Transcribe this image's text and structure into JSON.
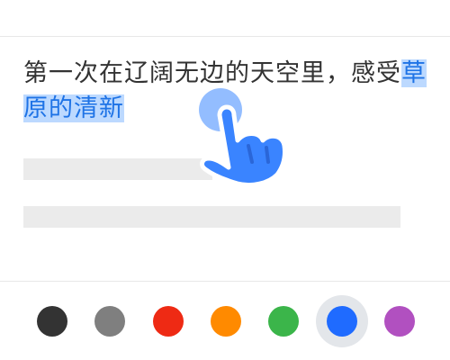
{
  "text": {
    "before_highlight": "第一次在辽阔无边的天空里，感受",
    "highlight": "草原的清新"
  },
  "gesture": {
    "icon": "tap-hand-icon"
  },
  "palette": {
    "colors": [
      {
        "name": "black",
        "hex": "#333333",
        "selected": false
      },
      {
        "name": "gray",
        "hex": "#7f7f7f",
        "selected": false
      },
      {
        "name": "red",
        "hex": "#ee2a14",
        "selected": false
      },
      {
        "name": "orange",
        "hex": "#ff8a00",
        "selected": false
      },
      {
        "name": "green",
        "hex": "#3bb54a",
        "selected": false
      },
      {
        "name": "blue",
        "hex": "#1f6bff",
        "selected": true
      },
      {
        "name": "purple",
        "hex": "#b150c0",
        "selected": false
      }
    ]
  },
  "theme": {
    "highlight_bg": "#bcd9ff",
    "highlight_text": "#1e73e6",
    "hand_blue": "#3a84ff"
  }
}
